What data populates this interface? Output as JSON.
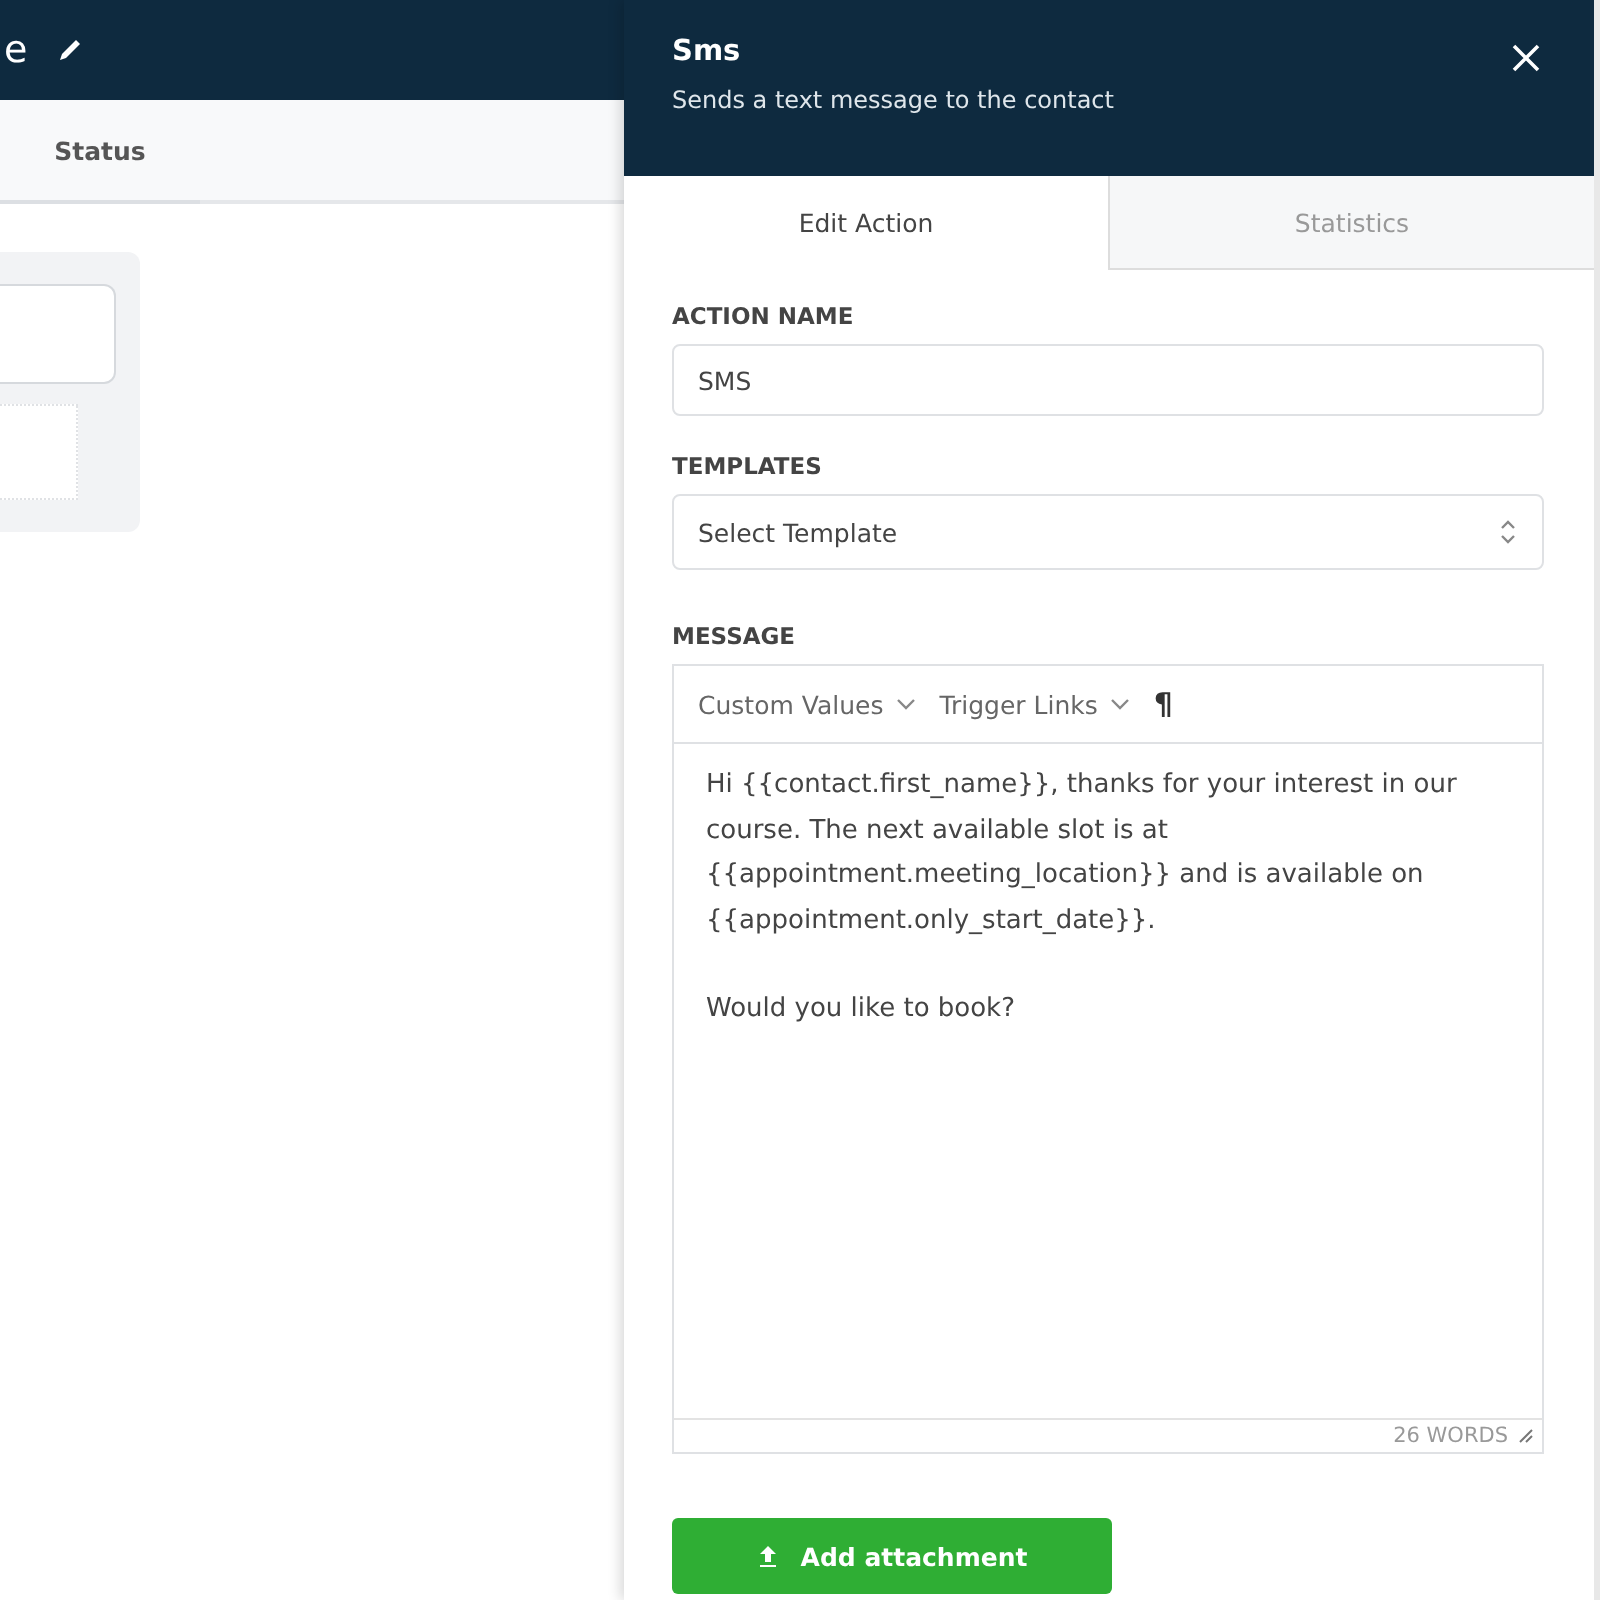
{
  "background": {
    "title": "e",
    "tabs": [
      {
        "label": "Status",
        "selected": true
      }
    ]
  },
  "panel": {
    "title": "Sms",
    "subtitle": "Sends a text message to the contact",
    "tabs": [
      {
        "label": "Edit Action",
        "selected": true
      },
      {
        "label": "Statistics",
        "selected": false
      }
    ],
    "action_name": {
      "label": "ACTION NAME",
      "value": "SMS"
    },
    "templates": {
      "label": "TEMPLATES",
      "placeholder": "Select Template"
    },
    "message": {
      "label": "MESSAGE",
      "toolbar": [
        "Custom Values",
        "Trigger Links"
      ],
      "paragraph_mark": "¶",
      "paragraphs": [
        "Hi {{contact.first_name}}, thanks for your interest in our course. The next available slot is at {{appointment.meeting_location}} and is available on {{appointment.only_start_date}}.",
        "Would you like to book?"
      ],
      "word_count": "26 WORDS"
    },
    "attach_button": "Add attachment"
  }
}
